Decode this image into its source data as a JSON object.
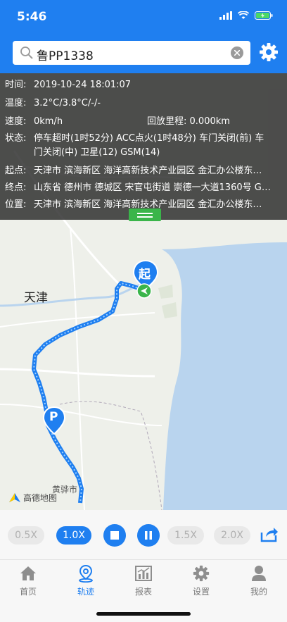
{
  "status_bar": {
    "time": "5:46"
  },
  "search": {
    "plate": "鲁PP1338"
  },
  "info": {
    "time_label": "时间:",
    "time_value": "2019-10-24 18:01:07",
    "temp_label": "温度:",
    "temp_value": "3.2°C/3.8°C/-/-",
    "speed_label": "速度:",
    "speed_value": "0km/h",
    "mileage_label": "回放里程:",
    "mileage_value": "0.000km",
    "state_label": "状态:",
    "state_line1": "停车超时(1时52分) ACC点火(1时48分) 车门关闭(前) 车",
    "state_line2": "门关闭(中) 卫星(12) GSM(14)",
    "start_label": "起点:",
    "start_value": "天津市 滨海新区 海洋高新技术产业园区 金汇办公楼东…",
    "end_label": "终点:",
    "end_value": "山东省 德州市 德城区 宋官屯街道 崇德一大道1360号 G…",
    "pos_label": "位置:",
    "pos_value": "天津市 滨海新区 海洋高新技术产业园区 金汇办公楼东…"
  },
  "map": {
    "city_tianjin": "天津",
    "city_huanghua": "黄骅市",
    "start_marker": "起",
    "parking_marker": "P",
    "logo_text": "高德地图"
  },
  "controls": {
    "speed_05": "0.5X",
    "speed_10": "1.0X",
    "speed_15": "1.5X",
    "speed_20": "2.0X"
  },
  "tabs": [
    {
      "label": "首页"
    },
    {
      "label": "轨迹"
    },
    {
      "label": "报表"
    },
    {
      "label": "设置"
    },
    {
      "label": "我的"
    }
  ],
  "colors": {
    "primary": "#1f7ff0",
    "green": "#3ab54a"
  }
}
